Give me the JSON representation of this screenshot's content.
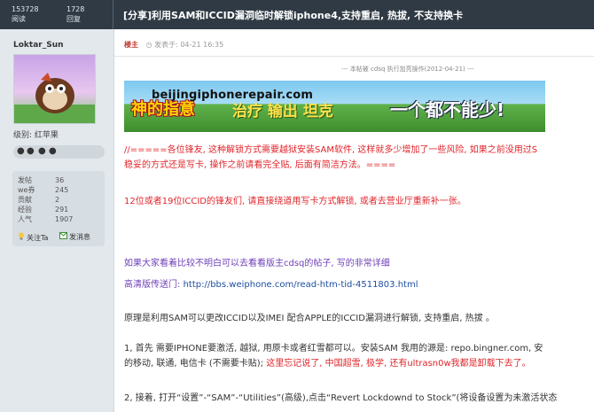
{
  "topbar": {
    "views_count": "153728",
    "views_label": "阅读",
    "replies_count": "1728",
    "replies_label": "回复",
    "title": "[分享]利用SAM和ICCID漏洞临时解锁iphone4,支持重启, 热拔, 不支持换卡"
  },
  "sidebar": {
    "username": "Loktar_Sun",
    "level": "级别: 红苹果",
    "stats": [
      {
        "label": "发帖",
        "value": "36"
      },
      {
        "label": "we券",
        "value": "245"
      },
      {
        "label": "贡献",
        "value": "2"
      },
      {
        "label": "经验",
        "value": "291"
      },
      {
        "label": "人气",
        "value": "1907"
      }
    ],
    "follow_label": "关注Ta",
    "message_label": "发消息"
  },
  "post": {
    "author_tag": "楼主",
    "posted_at": "发表于: 04-21 16:35",
    "edit_note": "--- 本帖被 cdsq 执行加亮操作(2012-04-21) ---",
    "watermark": "beijingiphonerepair.com",
    "banner": {
      "part1": "神的指意",
      "part2": "治疗 输出 坦克",
      "part3": "一个都不能少!"
    },
    "p1_line1": "//=====各位锋友, 这种解锁方式需要越狱安装SAM软件, 这样就多少增加了一些风险, 如果之前没用过S",
    "p1_line2": "稳妥的方式还是写卡, 操作之前请看完全贴, 后面有简洁方法。====",
    "p2": "12位或者19位ICCID的锋友们, 请直接绕道用写卡方式解锁, 或者去营业厅重新补一张。",
    "p3": "如果大家看着比较不明白可以去看看版主cdsq的帖子, 写的非常详细",
    "hd_label": "高清版传送门: ",
    "hd_url": "http://bbs.weiphone.com/read-htm-tid-4511803.html",
    "p4": "原理是利用SAM可以更改ICCID以及IMEI 配合APPLE的ICCID漏洞进行解锁, 支持重启, 热拔 。",
    "p5_line1": "1, 首先 需要IPHONE要激活, 越狱, 用原卡或者红雪都可以。安装SAM 我用的源是: repo.bingner.com, 安",
    "p5_line2_a": "的移动, 联通, 电信卡 (不需要卡贴); ",
    "p5_line2_b": "这里忘记说了, 中国超雪, 极学, 还有ultrasn0w我都是卸载下去了。",
    "p6": "2, 接着, 打开“设置”-“SAM”-“Utilities”(高级),点击“Revert Lockdownd to Stock”(将设备设置为未激活状态"
  }
}
